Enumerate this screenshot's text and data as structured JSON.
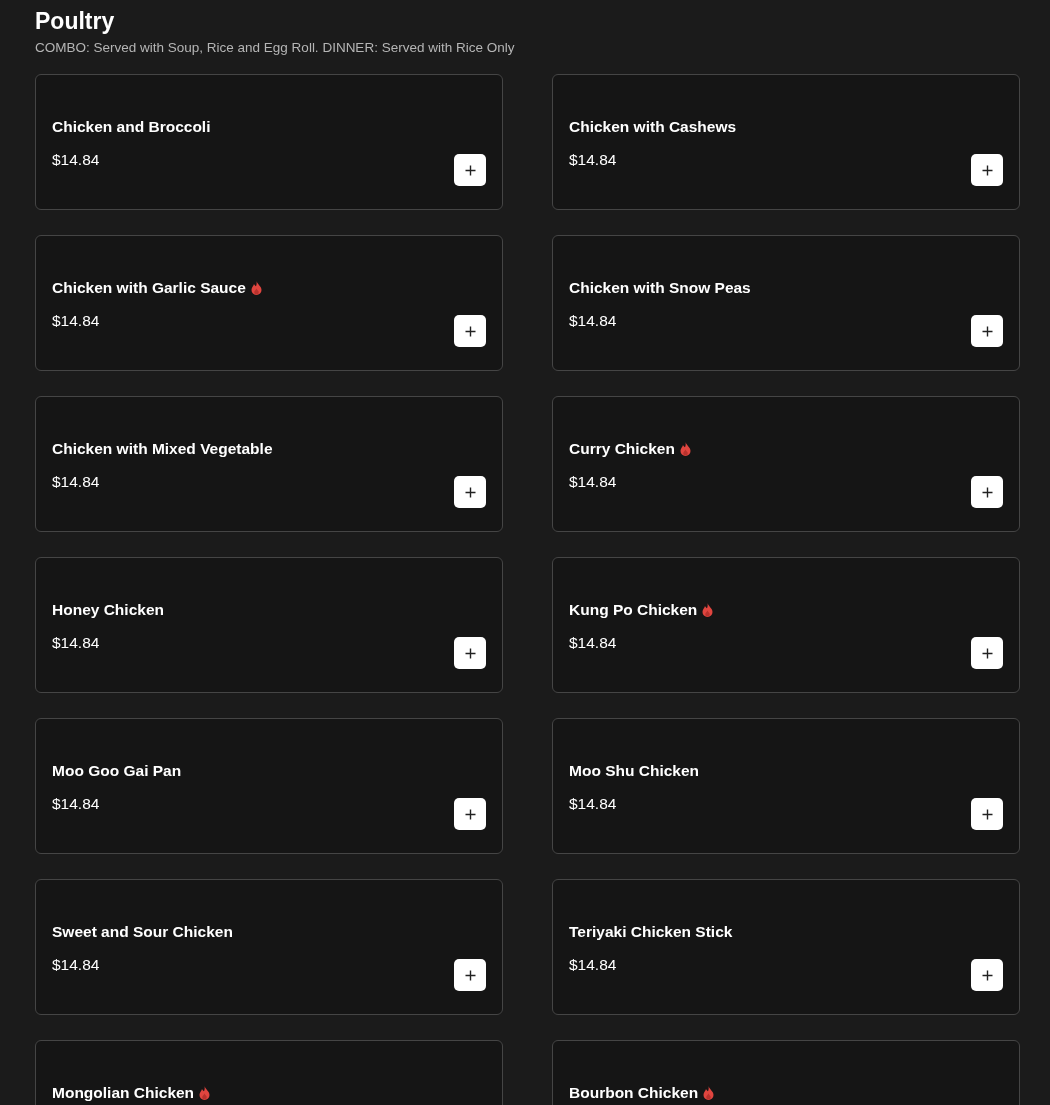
{
  "section": {
    "title": "Poultry",
    "description": "COMBO: Served with Soup, Rice and Egg Roll. DINNER: Served with Rice Only"
  },
  "items": [
    {
      "name": "Chicken and Broccoli",
      "spicy": false,
      "price": "$14.84"
    },
    {
      "name": "Chicken with Cashews",
      "spicy": false,
      "price": "$14.84"
    },
    {
      "name": "Chicken with Garlic Sauce",
      "spicy": true,
      "price": "$14.84"
    },
    {
      "name": "Chicken with Snow Peas",
      "spicy": false,
      "price": "$14.84"
    },
    {
      "name": "Chicken with Mixed Vegetable",
      "spicy": false,
      "price": "$14.84"
    },
    {
      "name": "Curry Chicken",
      "spicy": true,
      "price": "$14.84"
    },
    {
      "name": "Honey Chicken",
      "spicy": false,
      "price": "$14.84"
    },
    {
      "name": "Kung Po Chicken",
      "spicy": true,
      "price": "$14.84"
    },
    {
      "name": "Moo Goo Gai Pan",
      "spicy": false,
      "price": "$14.84"
    },
    {
      "name": "Moo Shu Chicken",
      "spicy": false,
      "price": "$14.84"
    },
    {
      "name": "Sweet and Sour Chicken",
      "spicy": false,
      "price": "$14.84"
    },
    {
      "name": "Teriyaki Chicken Stick",
      "spicy": false,
      "price": "$14.84"
    },
    {
      "name": "Mongolian Chicken",
      "spicy": true
    },
    {
      "name": "Bourbon Chicken",
      "spicy": true
    }
  ]
}
